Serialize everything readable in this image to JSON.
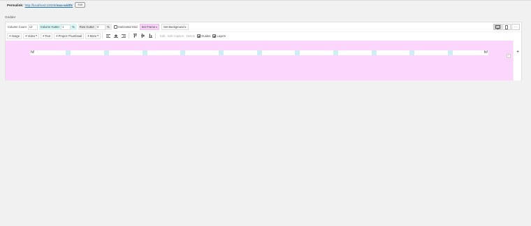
{
  "permalink": {
    "label": "Permalink:",
    "url_prefix": "http://localhost:10026/",
    "url_slug": "max-width",
    "url_suffix": "/",
    "edit_label": "Edit"
  },
  "section": {
    "title": "Gridder"
  },
  "settings": {
    "column_count_label": "Column Count",
    "column_count_value": "12",
    "column_gutter_label": "Column Gutter",
    "column_gutter_value": "1",
    "column_gutter_unit": "%",
    "row_gutter_label": "Row Gutter",
    "row_gutter_value": "0",
    "row_gutter_unit": "%",
    "horizontal_grid_label": "Horizontal Grid",
    "horizontal_grid_checked": false,
    "set_frame_label": "Set Frame",
    "set_background_label": "Set Background"
  },
  "view_buttons": {
    "icons": [
      "desktop-icon",
      "phone-icon",
      "more-icon"
    ],
    "more_label": "···"
  },
  "toolbar": {
    "image_label": "Image",
    "video_label": "Video",
    "text_label": "Text",
    "project_thumbnail_label": "Project Thumbnail",
    "more_label": "More",
    "edit_label": "Edit",
    "edit_caption_label": "Edit Caption",
    "delete_label": "Delete",
    "guides_label": "Guides",
    "guides_checked": true,
    "layers_label": "Layers",
    "layers_checked": true
  },
  "grid": {
    "columns": 12,
    "left_text": "hi!",
    "right_text": "hi!",
    "add_icon": "+",
    "collapse_icon": "‹"
  },
  "colors": {
    "canvas_bg": "#fdd6fd",
    "gutter": "#cdeff4",
    "set_frame_bg": "#f7d4f7",
    "column_gutter_bg": "#d8f6f6"
  }
}
